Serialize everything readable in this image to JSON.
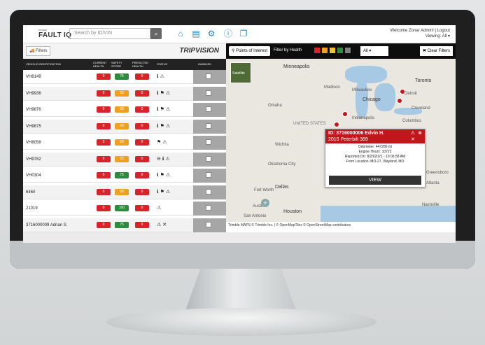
{
  "header": {
    "logo_small": "ZONAR",
    "logo": "FAULT IQ",
    "search_placeholder": "Search by ID/VIN",
    "welcome": "Welcome Zonar Admin! | Logout",
    "viewing": "Viewing: All ▾"
  },
  "left": {
    "filters_label": "Filters",
    "brand": "TRIPVISION",
    "columns": [
      "VEHICLE IDENTIFICATION",
      "CURRENT HEALTH",
      "SAFETY SCORE",
      "PREDICTED HEALTH",
      "STATUS",
      "HANDLED"
    ],
    "rows": [
      {
        "id": "VH8149",
        "current": "0",
        "safety": "75",
        "safety_color": "green",
        "predicted": "0",
        "status": "ℹ ⚠"
      },
      {
        "id": "VH9936",
        "current": "0",
        "safety": "50",
        "safety_color": "orange",
        "predicted": "0",
        "status": "ℹ ⚑ ⚠"
      },
      {
        "id": "VH9876",
        "current": "0",
        "safety": "50",
        "safety_color": "orange",
        "predicted": "0",
        "status": "ℹ ⚑ ⚠"
      },
      {
        "id": "VH9875",
        "current": "0",
        "safety": "50",
        "safety_color": "orange",
        "predicted": "0",
        "status": "ℹ ⚑ ⚠"
      },
      {
        "id": "VH8058",
        "current": "0",
        "safety": "50",
        "safety_color": "orange",
        "predicted": "0",
        "status": "⚑ ⚠"
      },
      {
        "id": "VH9782",
        "current": "0",
        "safety": "25",
        "safety_color": "orange",
        "predicted": "0",
        "status": "⊖ ℹ ⚠"
      },
      {
        "id": "VH0304",
        "current": "0",
        "safety": "75",
        "safety_color": "green",
        "predicted": "0",
        "status": "ℹ ⚑ ⚠"
      },
      {
        "id": "6460",
        "current": "0",
        "safety": "50",
        "safety_color": "orange",
        "predicted": "0",
        "status": "ℹ ⚑ ⚠"
      },
      {
        "id": "21019",
        "current": "0",
        "safety": "100",
        "safety_color": "green",
        "predicted": "0",
        "status": "⚠"
      },
      {
        "id": "3716000009 Adrian S.",
        "current": "0",
        "safety": "75",
        "safety_color": "green",
        "predicted": "0",
        "status": "⚠ ✕"
      }
    ]
  },
  "map": {
    "poi_label": "Points of Interest",
    "filter_health": "Filter by Health",
    "health_colors": [
      "#d9232a",
      "#f0a020",
      "#f2c230",
      "#2e8a3c",
      "#7d7d7d"
    ],
    "select_value": "All",
    "clear_label": "Clear Filters",
    "satellite": "Satellite",
    "labels": [
      "Minneapolis",
      "Toronto",
      "Madison",
      "Milwaukee",
      "Chicago",
      "Detroit",
      "Cleveland",
      "Omaha",
      "Indianapolis",
      "Columbus",
      "Wichita",
      "Oklahoma City",
      "Dallas",
      "Fort Worth",
      "Houston",
      "San Antonio",
      "Austin",
      "Nashville",
      "Atlanta",
      "Greensboro",
      "UNITED STATES"
    ],
    "popup": {
      "title": "ID: 3716000006 Edvin H.",
      "subtitle": "2016 Peterbilt 389",
      "odometer": "Odometer: 447286 mi",
      "engine": "Engine Hours: 10722",
      "reported": "Reported On: 8/23/2021 - 10:06:58 AM",
      "location": "From Location: MO-27, Wayland, MO",
      "view": "VIEW"
    },
    "attribution": "Trimble MAPS © Trimble Inc. | © OpenMapTiles © OpenStreetMap contributors"
  }
}
